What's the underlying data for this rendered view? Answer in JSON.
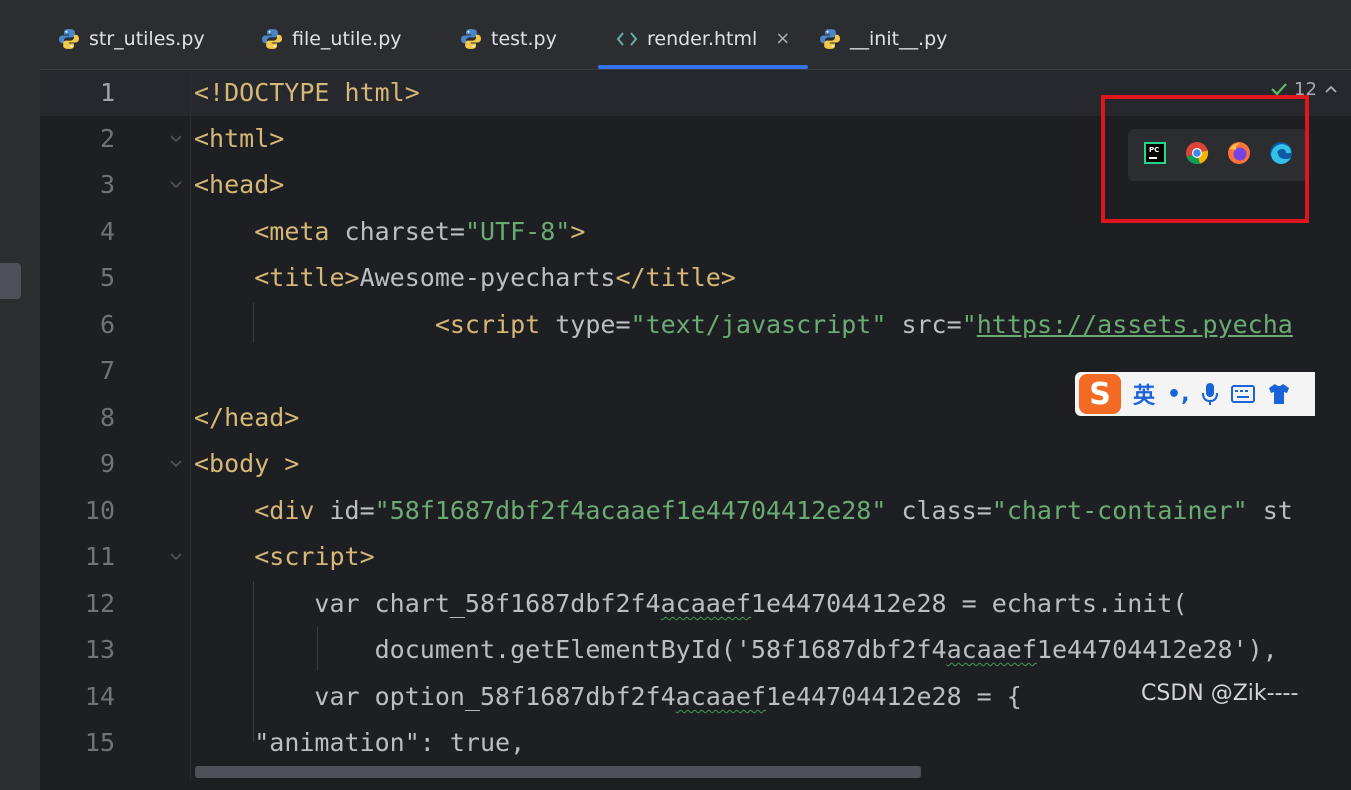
{
  "tabs": [
    {
      "label": "str_utiles.py",
      "type": "python",
      "active": false
    },
    {
      "label": "file_utile.py",
      "type": "python",
      "active": false
    },
    {
      "label": "test.py",
      "type": "python",
      "active": false
    },
    {
      "label": "render.html",
      "type": "html",
      "active": true,
      "close": "×"
    },
    {
      "label": "__init__.py",
      "type": "python",
      "active": false
    }
  ],
  "inspection": {
    "count": "12"
  },
  "browsers": [
    "pycharm-icon",
    "chrome-icon",
    "firefox-icon",
    "edge-icon"
  ],
  "ime": {
    "logo": "S",
    "mode": "英",
    "punct": "•,"
  },
  "watermark": "CSDN @Zik----",
  "colors": {
    "accent": "#3574f0",
    "tag": "#d5b778",
    "string": "#6aab73",
    "highlight": "#e0161f"
  },
  "lines": {
    "1": [
      "<!DOCTYPE html>"
    ],
    "2": [
      "<html>"
    ],
    "3": [
      "<head>"
    ],
    "4": [
      "<meta ",
      "charset",
      "=",
      "\"UTF-8\"",
      ">"
    ],
    "5": [
      "<title>",
      "Awesome-pyecharts",
      "</title>"
    ],
    "6": [
      "<script ",
      "type",
      "=",
      "\"text/javascript\"",
      " src",
      "=",
      "\"",
      "https://assets.pyecha"
    ],
    "7": [],
    "8": [
      "</head>"
    ],
    "9": [
      "<body >"
    ],
    "10": [
      "<div ",
      "id",
      "=",
      "\"58f1687dbf2f4acaaef1e44704412e28\"",
      " class",
      "=",
      "\"chart-container\"",
      " st"
    ],
    "11": [
      "<script>"
    ],
    "12": [
      "var chart_58f1687dbf2f4",
      "acaaef",
      "1e44704412e28 = echarts.init("
    ],
    "13": [
      "document.getElementById('58f1687dbf2f4",
      "acaaef",
      "1e44704412e28'),"
    ],
    "14": [
      "var option_58f1687dbf2f4",
      "acaaef",
      "1e44704412e28 = {"
    ],
    "15": [
      "\"animation\": true,"
    ]
  }
}
